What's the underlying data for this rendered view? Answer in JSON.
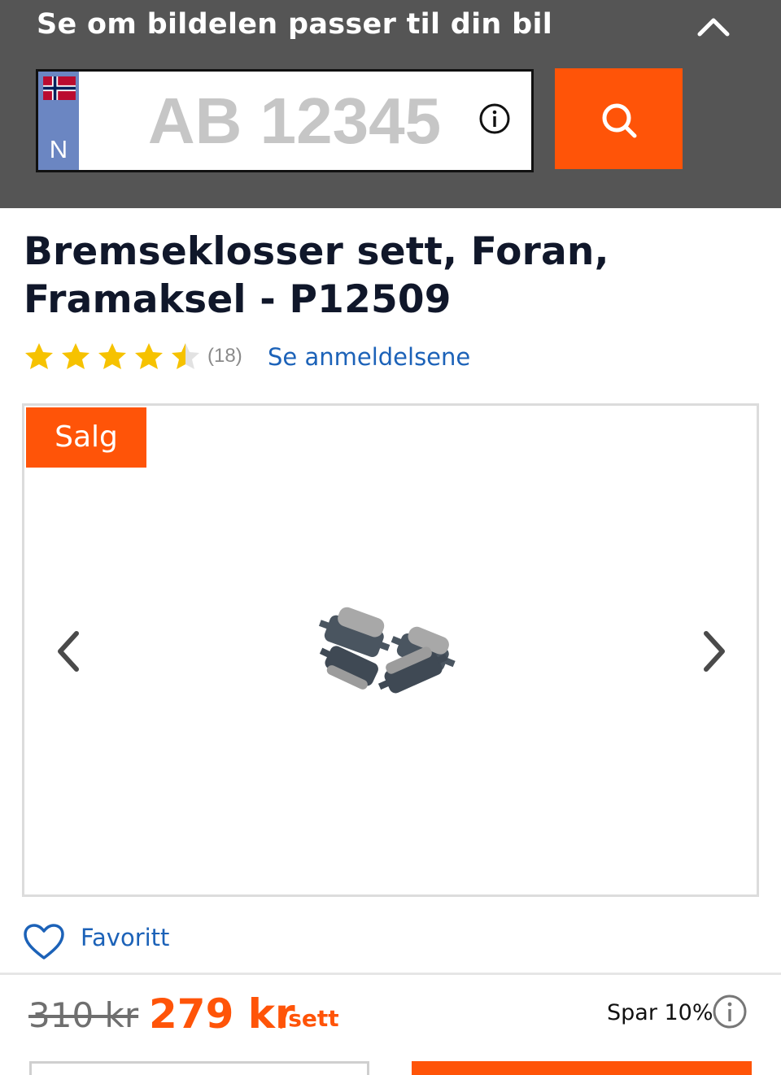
{
  "fit_check": {
    "title": "Se om bildelen passer til din bil",
    "collapse_icon": "chevron-up-icon",
    "plate": {
      "country_code": "N",
      "flag": "norway-flag",
      "placeholder": "AB 12345",
      "value": "",
      "info_icon": "info-icon"
    },
    "search_icon": "search-icon",
    "accent_color": "#ff5408"
  },
  "product": {
    "title": "Bremseklosser sett, Foran, Framaksel - P12509",
    "rating": {
      "stars": 4.5,
      "max_stars": 5,
      "review_count": "(18)",
      "reviews_link": "Se anmeldelsene"
    },
    "gallery": {
      "badge": "Salg",
      "prev_icon": "chevron-left-icon",
      "next_icon": "chevron-right-icon",
      "image": "brake-pads-set"
    },
    "favorite": {
      "icon": "heart-icon",
      "label": "Favoritt"
    },
    "price": {
      "old": "310 kr",
      "new": "279 kr",
      "unit": "/sett",
      "savings": "Spar 10%",
      "savings_icon": "info-icon"
    }
  },
  "colors": {
    "header_bg": "#555555",
    "link": "#1c62b8",
    "star": "#f6c200",
    "title": "#10172a"
  }
}
